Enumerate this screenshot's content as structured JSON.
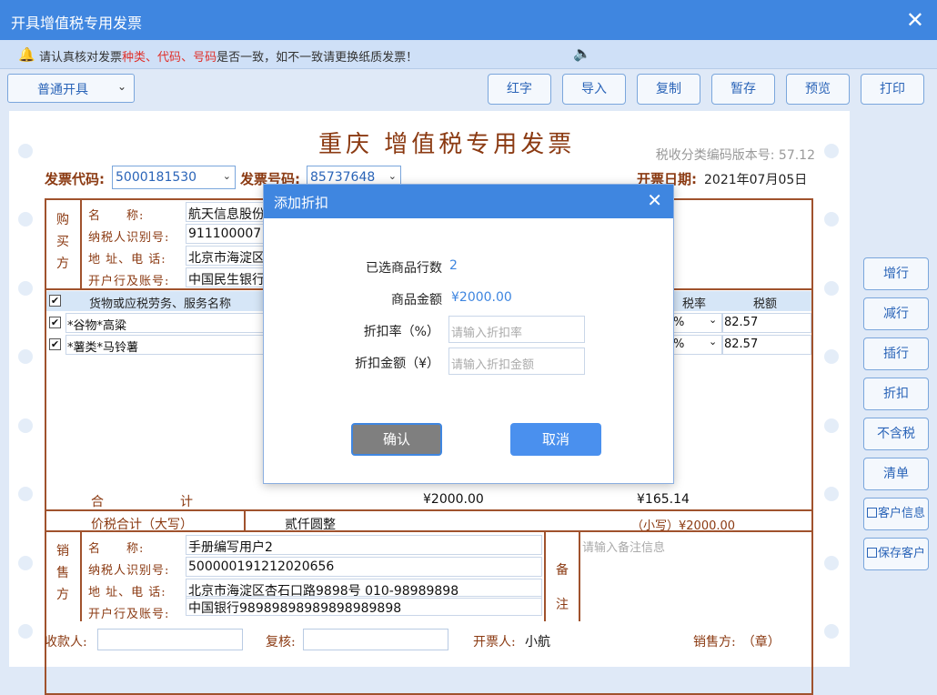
{
  "window": {
    "title": "开具增值税专用发票",
    "close": "✕"
  },
  "notice": {
    "prefix": "请认真核对发票",
    "k1": "种类",
    "sep1": "、",
    "k2": "代码",
    "sep2": "、",
    "k3": "号码",
    "suffix": "是否一致，如不一致请更换纸质发票！"
  },
  "toolbar": {
    "mode_select": "普通开具",
    "buttons": [
      "红字",
      "导入",
      "复制",
      "暂存",
      "预览",
      "打印"
    ]
  },
  "invoice": {
    "title": "重庆 增值税专用发票",
    "version_label": "税收分类编码版本号: 57.12",
    "code_label": "发票代码:",
    "code_value": "5000181530",
    "number_label": "发票号码:",
    "number_value": "85737648",
    "date_label": "开票日期:",
    "date_value": "2021年07月05日",
    "buyer": {
      "side_label": [
        "购",
        "买",
        "方"
      ],
      "name_label": "名　　称:",
      "name_value": "航天信息股份",
      "tax_label": "纳税人识别号:",
      "tax_value": "911100007",
      "addr_label": "地 址、电 话:",
      "addr_value": "北京市海淀区",
      "bank_label": "开户行及账号:",
      "bank_value": "中国民生银行"
    },
    "table": {
      "head_name": "货物或应税劳务、服务名称",
      "head_rate": "税率",
      "head_tax": "税额",
      "rows": [
        {
          "name": "*谷物*高粱",
          "rate": "%",
          "tax": "82.57",
          "checked": "✔"
        },
        {
          "name": "*薯类*马铃薯",
          "rate": "%",
          "tax": "82.57",
          "checked": "✔"
        }
      ],
      "head_check": "✔"
    },
    "total_label": "合　　　　　　计",
    "total_amount": "¥2000.00",
    "total_tax": "¥165.14",
    "grand_label": "价税合计（大写）",
    "grand_words": "贰仟圆整",
    "grand_small": "（小写）¥2000.00",
    "seller": {
      "side_label": [
        "销",
        "售",
        "方"
      ],
      "name_label": "名　　称:",
      "name_value": "手册编写用户2",
      "tax_label": "纳税人识别号:",
      "tax_value": "500000191212020656",
      "addr_label": "地 址、电 话:",
      "addr_value": "北京市海淀区杏石口路9898号 010-98989898",
      "bank_label": "开户行及账号:",
      "bank_value": "中国银行98989898989898989898"
    },
    "remark_side": [
      "备",
      "注"
    ],
    "remark_placeholder": "请输入备注信息",
    "payee_label": "收款人:",
    "reviewer_label": "复核:",
    "drawer_label": "开票人:",
    "drawer_value": "小航",
    "seller_stamp_label": "销售方:　（章）"
  },
  "side_buttons": [
    "增行",
    "减行",
    "插行",
    "折扣",
    "不含税",
    "清单",
    "客户信息",
    "保存客户"
  ],
  "dialog": {
    "title": "添加折扣",
    "close": "✕",
    "rows_label": "已选商品行数",
    "rows_value": "2",
    "amount_label": "商品金额",
    "amount_value": "¥2000.00",
    "rate_label": "折扣率（%）",
    "rate_placeholder": "请输入折扣率",
    "disc_label": "折扣金额（¥）",
    "disc_placeholder": "请输入折扣金额",
    "ok": "确认",
    "cancel": "取消"
  },
  "icons": {
    "bell": "bell-icon",
    "speaker": "speaker-icon",
    "chevron": "chevron-down-icon"
  },
  "colors": {
    "accent": "#3f86e0",
    "invoice_brown": "#8b3a12",
    "warning_red": "#e0302a"
  }
}
